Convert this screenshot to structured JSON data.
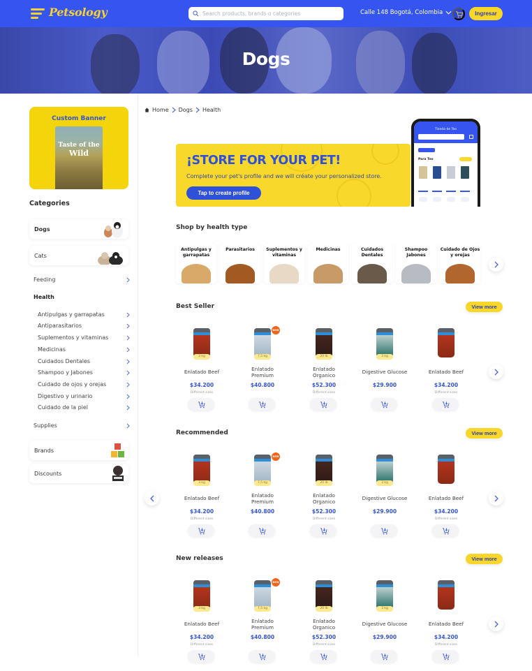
{
  "header": {
    "logo": "Petsology",
    "search_placeholder": "Search products, brands o categories",
    "location": "Calle 148 Bogotá, Colombia",
    "login_label": "Ingresar"
  },
  "hero": {
    "title": "Dogs"
  },
  "sidebar": {
    "custom_banner": {
      "title": "Custom Banner",
      "product_line1": "Taste of the",
      "product_line2": "Wild"
    },
    "categories_heading": "Categories",
    "top_items": [
      {
        "label": "Dogs",
        "active": true
      },
      {
        "label": "Cats",
        "active": false
      }
    ],
    "feeding": "Feeding",
    "health": "Health",
    "health_items": [
      "Antipulgas y garrapatas",
      "Antiparasitarios",
      "Suplementos y vitaminas",
      "Medicinas",
      "Cuidados Dentales",
      "Shampoo y Jabones",
      "Cuidado de ojos y orejas",
      "Digestivo y urinario",
      "Cuidado de la piel"
    ],
    "supplies": "Supplies",
    "bottom_items": [
      {
        "label": "Brands"
      },
      {
        "label": "Discounts"
      }
    ]
  },
  "breadcrumb": [
    "Home",
    "Dogs",
    "Health"
  ],
  "promo": {
    "title": "¡STORE FOR YOUR PET!",
    "subtitle": "Complete your pet's profile and we will créate your personalized store.",
    "button": "Tap to create profile",
    "phone_title": "Tienda de Teo",
    "phone_section": "Para Teo"
  },
  "health_types": {
    "title": "Shop by health type",
    "items": [
      "Antipulgas y garrapatas",
      "Parasitarios",
      "Suplementos y vitaminas",
      "Medicinas",
      "Cuidados Dentales",
      "Shampoo Jabones",
      "Cuidado de Ojos y orejas"
    ]
  },
  "sections": [
    {
      "title": "Best Seller",
      "view_more": "View more"
    },
    {
      "title": "Recommended",
      "view_more": "View more"
    },
    {
      "title": "New releases",
      "view_more": "View more"
    }
  ],
  "products": [
    {
      "name": "Enlatado Beef",
      "price": "$34.200",
      "size": "3 kg",
      "note": "Different sizes",
      "new": false
    },
    {
      "name": "Enlatado Premium",
      "price": "$40.800",
      "size": "7,5 kg",
      "note": "",
      "new": true,
      "new_label": "NEW"
    },
    {
      "name": "Enlatado Organico",
      "price": "$52.300",
      "size": "20 lb",
      "note": "Different sizes",
      "new": false
    },
    {
      "name": "Digestive Glucose",
      "price": "$29.900",
      "size": "3 kg",
      "note": "",
      "new": false
    },
    {
      "name": "Enlatado Beef",
      "price": "$34.200",
      "size": "",
      "note": "Different sizes",
      "new": false
    }
  ],
  "colors": {
    "primary": "#3554f0",
    "accent": "#f9d72a",
    "price": "#3554d8"
  }
}
